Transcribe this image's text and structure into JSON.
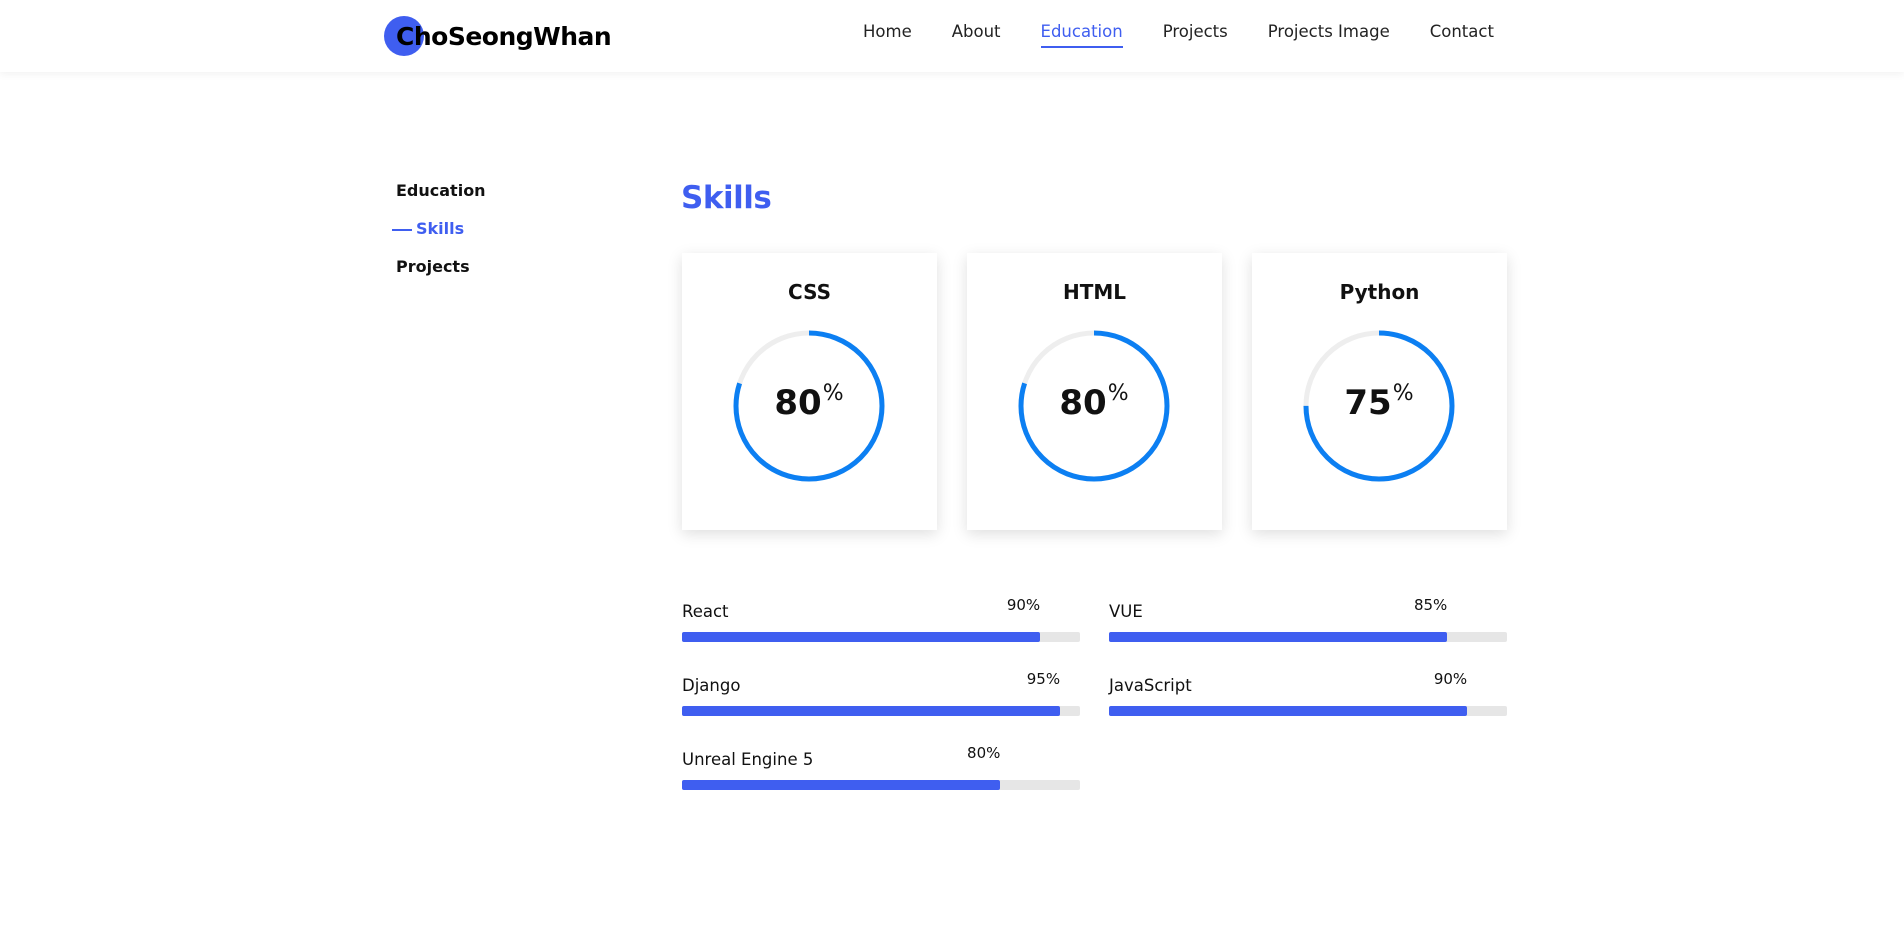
{
  "header": {
    "logo_text": "ChoSeongWhan",
    "nav": [
      {
        "label": "Home",
        "active": false
      },
      {
        "label": "About",
        "active": false
      },
      {
        "label": "Education",
        "active": true
      },
      {
        "label": "Projects",
        "active": false
      },
      {
        "label": "Projects Image",
        "active": false
      },
      {
        "label": "Contact",
        "active": false
      }
    ]
  },
  "sidenav": {
    "items": [
      {
        "label": "Education",
        "active": false
      },
      {
        "label": "Skills",
        "active": true
      },
      {
        "label": "Projects",
        "active": false
      }
    ]
  },
  "main": {
    "title": "Skills",
    "circle_skills": [
      {
        "name": "CSS",
        "value": "80",
        "unit": "%",
        "percent": 80
      },
      {
        "name": "HTML",
        "value": "80",
        "unit": "%",
        "percent": 80
      },
      {
        "name": "Python",
        "value": "75",
        "unit": "%",
        "percent": 75
      }
    ],
    "bar_skills": [
      {
        "name": "React",
        "value": "90%",
        "percent": 90
      },
      {
        "name": "VUE",
        "value": "85%",
        "percent": 85
      },
      {
        "name": "Django",
        "value": "95%",
        "percent": 95
      },
      {
        "name": "JavaScript",
        "value": "90%",
        "percent": 90
      },
      {
        "name": "Unreal Engine 5",
        "value": "80%",
        "percent": 80
      }
    ]
  },
  "colors": {
    "accent": "#3f5ef0",
    "ring_stroke": "#0c7ff2",
    "ring_track": "#eeeeee",
    "bar_track": "#e6e6e6"
  }
}
